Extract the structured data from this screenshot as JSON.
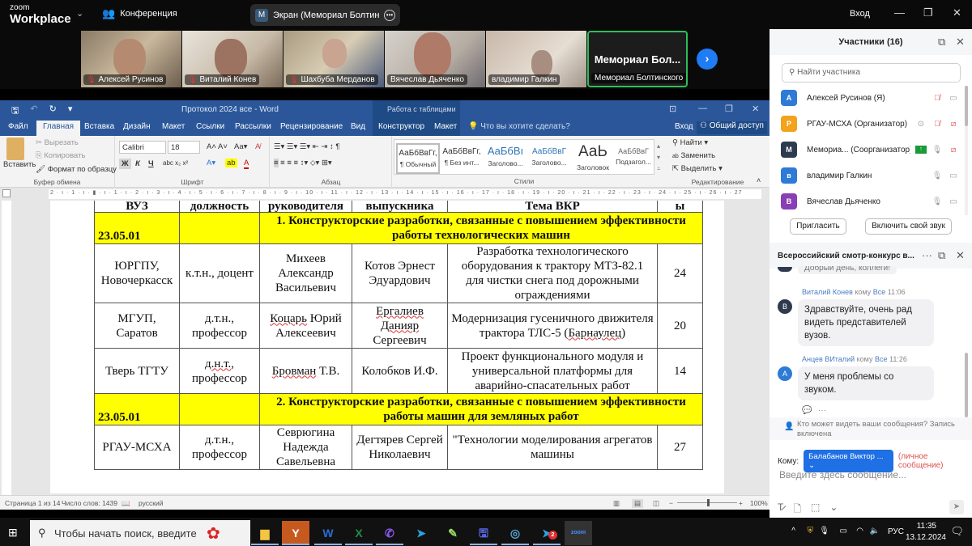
{
  "zoom": {
    "logo_top": "zoom",
    "logo_bottom": "Workplace",
    "meeting_label": "Конференция",
    "screen_share_avatar": "M",
    "screen_share_label": "Экран (Мемориал Болтинскогс",
    "signin": "Вход",
    "videos": [
      {
        "name": "Алексей Русинов",
        "muted": true
      },
      {
        "name": "Виталий Конев",
        "muted": true
      },
      {
        "name": "Шахбуба Мерданов",
        "muted": true
      },
      {
        "name": "Вячеслав Дьяченко",
        "muted": false
      },
      {
        "name": "владимир Галкин",
        "muted": false
      },
      {
        "name": "Мемориал Болтинского ...",
        "big": "Мемориал  Бол...",
        "muted": false,
        "active": true
      }
    ]
  },
  "word": {
    "title": "Протокол 2024 все - Word",
    "table_tools": "Работа с таблицами",
    "tabs": [
      "Файл",
      "Главная",
      "Вставка",
      "Дизайн",
      "Макет",
      "Ссылки",
      "Рассылки",
      "Рецензирование",
      "Вид",
      "Конструктор",
      "Макет"
    ],
    "active_tab": "Главная",
    "tell_me": "Что вы хотите сделать?",
    "signin": "Вход",
    "share": "Общий доступ",
    "clipboard": {
      "paste": "Вставить",
      "cut": "Вырезать",
      "copy": "Копировать",
      "format_painter": "Формат по образцу",
      "label": "Буфер обмена"
    },
    "font": {
      "name": "Calibri",
      "size": "18",
      "label": "Шрифт",
      "bold": "Ж",
      "italic": "К",
      "underline": "Ч"
    },
    "paragraph_label": "Абзац",
    "styles": [
      {
        "preview": "АаБбВвГг,",
        "name": "¶ Обычный"
      },
      {
        "preview": "АаБбВвГг,",
        "name": "¶ Без инт..."
      },
      {
        "preview": "АаБбВı",
        "name": "Заголово..."
      },
      {
        "preview": "АаБбВвГ",
        "name": "Заголово..."
      },
      {
        "preview": "АаЬ",
        "name": "Заголовок"
      },
      {
        "preview": "АаБбВвГ",
        "name": "Подзагол..."
      }
    ],
    "styles_label": "Стили",
    "editing": {
      "find": "Найти",
      "replace": "Заменить",
      "select": "Выделить",
      "label": "Редактирование"
    },
    "ruler": "2 · ı · 1 · ı · ▮ · ı · 1 · ı · 2 · ı · 3 · ı · 4 · ı · 5 · ı · 6 · ı · 7 · ı · 8 · ı · 9 · ı · 10 · ı · 11 · ı · 12 · ı · 13 · ı · 14 · ı · 15 · ı · 16 · ı · 17 · ı · 18 · ı · 19 · ı · 20 · ı · 21 · ı · 22 · ı · 23 · ı · 24 · ı · 25 · ı · 26 · ı · 27",
    "status": {
      "page": "Страница 1 из 14",
      "words": "Число слов: 1439",
      "language": "русский",
      "zoom": "100%",
      "zoom_level_percent": 100
    }
  },
  "table": {
    "header": [
      "ВУЗ",
      "должность",
      "руководителя",
      "выпускника",
      "Тема ВКР",
      "ы"
    ],
    "sections": [
      {
        "code": "23.05.01",
        "title": "1. Конструкторские разработки, связанные с повышением эффективности работы технологических машин",
        "rows": [
          {
            "vuz": "ЮРГПУ, Новочеркасск",
            "position": "к.т.н., доцент",
            "supervisor": "Михеев Александр Васильевич",
            "graduate": "Котов Эрнест Эдуардович",
            "topic": "Разработка технологического оборудования к трактору МТЗ-82.1 для чистки снега под дорожными ограждениями",
            "score": "24"
          },
          {
            "vuz": "МГУП, Саратов",
            "position": "д.т.н., профессор",
            "supervisor": "Коцарь Юрий Алексеевич",
            "graduate": "Ергалиев Данияр Сергеевич",
            "topic": "Модернизация гусеничного движителя трактора ТЛС-5 (Барнаулец)",
            "score": "20"
          },
          {
            "vuz": "Тверь ТГТУ",
            "position": "д.н.т., профессор",
            "supervisor": "Бровман Т.В.",
            "graduate": "Колобков И.Ф.",
            "topic": "Проект функционального модуля и универсальной платформы для аварийно-спасательных работ",
            "score": "14"
          }
        ]
      },
      {
        "code": "23.05.01",
        "title": "2. Конструкторские разработки, связанные с повышением эффективности работы машин для земляных работ",
        "rows": [
          {
            "vuz": "РГАУ-МСХА",
            "position": "д.т.н., профессор",
            "supervisor": "Севрюгина Надежда Савельевна",
            "graduate": "Дегтярев Сергей Николаевич",
            "topic": "\"Технологии моделирования агрегатов машины",
            "score": "27"
          }
        ]
      }
    ]
  },
  "participants": {
    "title": "Участники (16)",
    "search_placeholder": "Найти участника",
    "list": [
      {
        "initial": "А",
        "name": "Алексей Русинов (Я)",
        "color": "#2d7bd6",
        "mic": "muted",
        "video": "off-grey"
      },
      {
        "initial": "Р",
        "name": "РГАУ-МСХА (Организатор)",
        "color": "#f2a31b",
        "mic": "muted",
        "video": "off"
      },
      {
        "initial": "М",
        "name": "Мемориа...  (Соорганизатор)",
        "color": "#2e3b4e",
        "mic": "on",
        "video": "off"
      },
      {
        "initial": "в",
        "name": "владимир Галкин",
        "color": "#2d7bd6",
        "mic": "on",
        "video": "on"
      },
      {
        "initial": "В",
        "name": "Вячеслав Дьяченко",
        "color": "#8a3fb5",
        "mic": "on",
        "video": "on"
      }
    ],
    "invite": "Пригласить",
    "unmute": "Включить свой звук"
  },
  "chat": {
    "title": "Всероссийский смотр-конкурс в...",
    "partial_message": "Добрый день, коллеги!",
    "messages": [
      {
        "sender": "Виталий Конев",
        "to_word": "кому",
        "to": "Все",
        "time": "11:06",
        "initial": "В",
        "color": "#2e3b4e",
        "text": "Здравствуйте, очень рад видеть представителей вузов."
      },
      {
        "sender": "Анцев ВИталий",
        "to_word": "кому",
        "to": "Все",
        "time": "11:26",
        "initial": "А",
        "color": "#2d7bd6",
        "text": "У меня проблемы со звуком."
      }
    ],
    "notice": "Кто может видеть ваши сообщения? Запись включена",
    "to_label": "Кому:",
    "recipient": "Балабанов Виктор ...",
    "private": "(личное сообщение)",
    "input_placeholder": "Введите здесь сообщение..."
  },
  "taskbar": {
    "search_placeholder": "Чтобы начать поиск, введите",
    "apps": [
      "file-explorer",
      "yandex-browser",
      "word",
      "excel",
      "viber",
      "telegram",
      "app-pen",
      "save-app",
      "app-circle",
      "telegram-2",
      "zoom"
    ],
    "telegram_badge": "2",
    "language": "РУС",
    "time": "11:35",
    "date": "13.12.2024"
  }
}
